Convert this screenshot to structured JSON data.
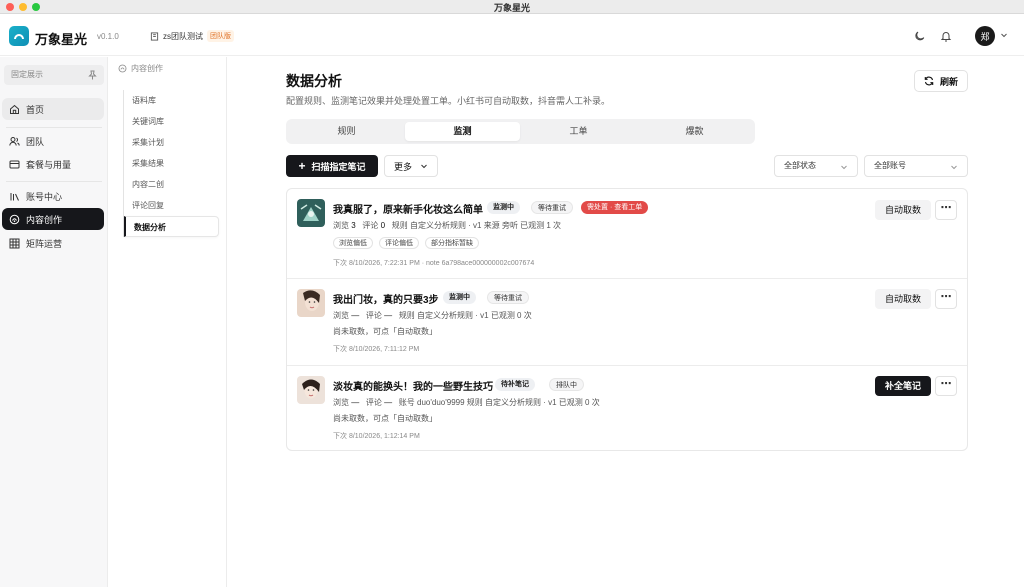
{
  "window": {
    "title": "万象星光"
  },
  "header": {
    "app_name": "万象星光",
    "version": "v0.1.0",
    "team_name": "zs团队测试",
    "team_badge": "团队版",
    "avatar_text": "郑"
  },
  "sidebar": {
    "pin_label": "固定展示",
    "items": [
      {
        "label": "首页",
        "icon": "home-icon"
      },
      {
        "label": "团队",
        "icon": "team-icon"
      },
      {
        "label": "套餐与用量",
        "icon": "package-icon"
      },
      {
        "label": "账号中心",
        "icon": "account-icon"
      },
      {
        "label": "内容创作",
        "icon": "create-icon",
        "active": true
      },
      {
        "label": "矩阵运营",
        "icon": "grid-icon"
      }
    ]
  },
  "subsidebar": {
    "heading": "内容创作",
    "items": [
      {
        "label": "语料库"
      },
      {
        "label": "关键词库"
      },
      {
        "label": "采集计划"
      },
      {
        "label": "采集结果"
      },
      {
        "label": "内容二创"
      },
      {
        "label": "评论回复"
      },
      {
        "label": "数据分析",
        "active": true
      }
    ]
  },
  "main": {
    "title": "数据分析",
    "description": "配置规则、监测笔记效果并处理处置工单。小红书可自动取数，抖音需人工补录。",
    "refresh_label": "刷新",
    "tabs": [
      {
        "label": "规则"
      },
      {
        "label": "监测",
        "active": true
      },
      {
        "label": "工单"
      },
      {
        "label": "爆款"
      }
    ],
    "scan_label": "扫描指定笔记",
    "more_label": "更多",
    "status_filter": "全部状态",
    "account_filter": "全部账号"
  },
  "notes": [
    {
      "title": "我真服了，原来新手化妆这么简单",
      "tags": [
        "监测中",
        "等待重试",
        "需处置 · 查看工单"
      ],
      "meta_views_label": "浏览",
      "meta_views": "3",
      "meta_comments_label": "评论",
      "meta_comments": "0",
      "meta_rest": "规则 自定义分析规则 · v1   来源 旁听   已观测 1 次",
      "chips": [
        "浏览偏低",
        "评论偏低",
        "部分指标暂缺"
      ],
      "next": "下次 8/10/2026, 7:22:31 PM · note 6a798ace000000002c007674",
      "action": "自动取数"
    },
    {
      "title": "我出门妆，真的只要3步",
      "tags": [
        "监测中",
        "等待重试"
      ],
      "meta_views_label": "浏览",
      "meta_views": "—",
      "meta_comments_label": "评论",
      "meta_comments": "—",
      "meta_rest": "规则 自定义分析规则 · v1   已观测 0 次",
      "sub": "尚未取数，可点「自动取数」",
      "next": "下次 8/10/2026, 7:11:12 PM",
      "action": "自动取数"
    },
    {
      "title": "淡妆真的能换头！我的一些野生技巧",
      "tags": [
        "待补笔记",
        "排队中"
      ],
      "meta_views_label": "浏览",
      "meta_views": "—",
      "meta_comments_label": "评论",
      "meta_comments": "—",
      "meta_rest": "账号 duo'duo'9999   规则 自定义分析规则 · v1   已观测 0 次",
      "sub": "尚未取数，可点「自动取数」",
      "next": "下次 8/10/2026, 1:12:14 PM",
      "action": "补全笔记"
    }
  ],
  "colors": {
    "primary": "#16171b",
    "danger": "#e24a48",
    "brand": "#1ab0c9"
  }
}
